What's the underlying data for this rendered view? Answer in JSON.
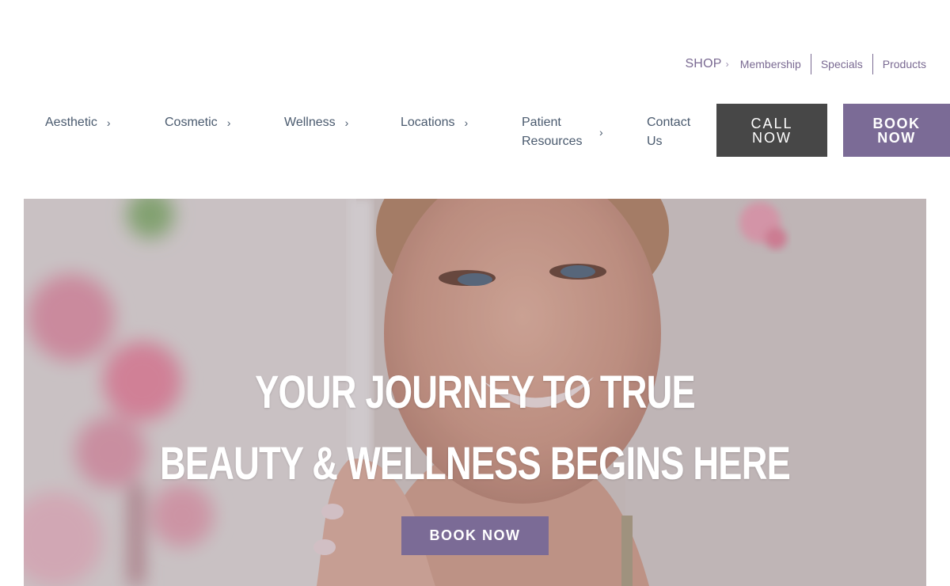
{
  "utility": {
    "shop_label": "SHOP",
    "links": [
      "Membership",
      "Specials",
      "Products"
    ]
  },
  "nav": {
    "items": [
      {
        "label": "Aesthetic"
      },
      {
        "label": "Cosmetic"
      },
      {
        "label": "Wellness"
      },
      {
        "label": "Locations"
      },
      {
        "label": "Patient Resources"
      },
      {
        "label": "Contact Us"
      }
    ],
    "call_label_line1": "CALL",
    "call_label_line2": "NOW",
    "book_label_line1": "BOOK",
    "book_label_line2": "NOW"
  },
  "hero": {
    "title_line1": "YOUR JOURNEY TO TRUE",
    "title_line2": "BEAUTY & WELLNESS BEGINS HERE",
    "button_label": "BOOK NOW"
  },
  "colors": {
    "accent": "#7b6b96",
    "call_button": "#474747",
    "nav_text": "#4a5a6e"
  },
  "icons": {
    "chevron": "chevron-right-icon"
  }
}
